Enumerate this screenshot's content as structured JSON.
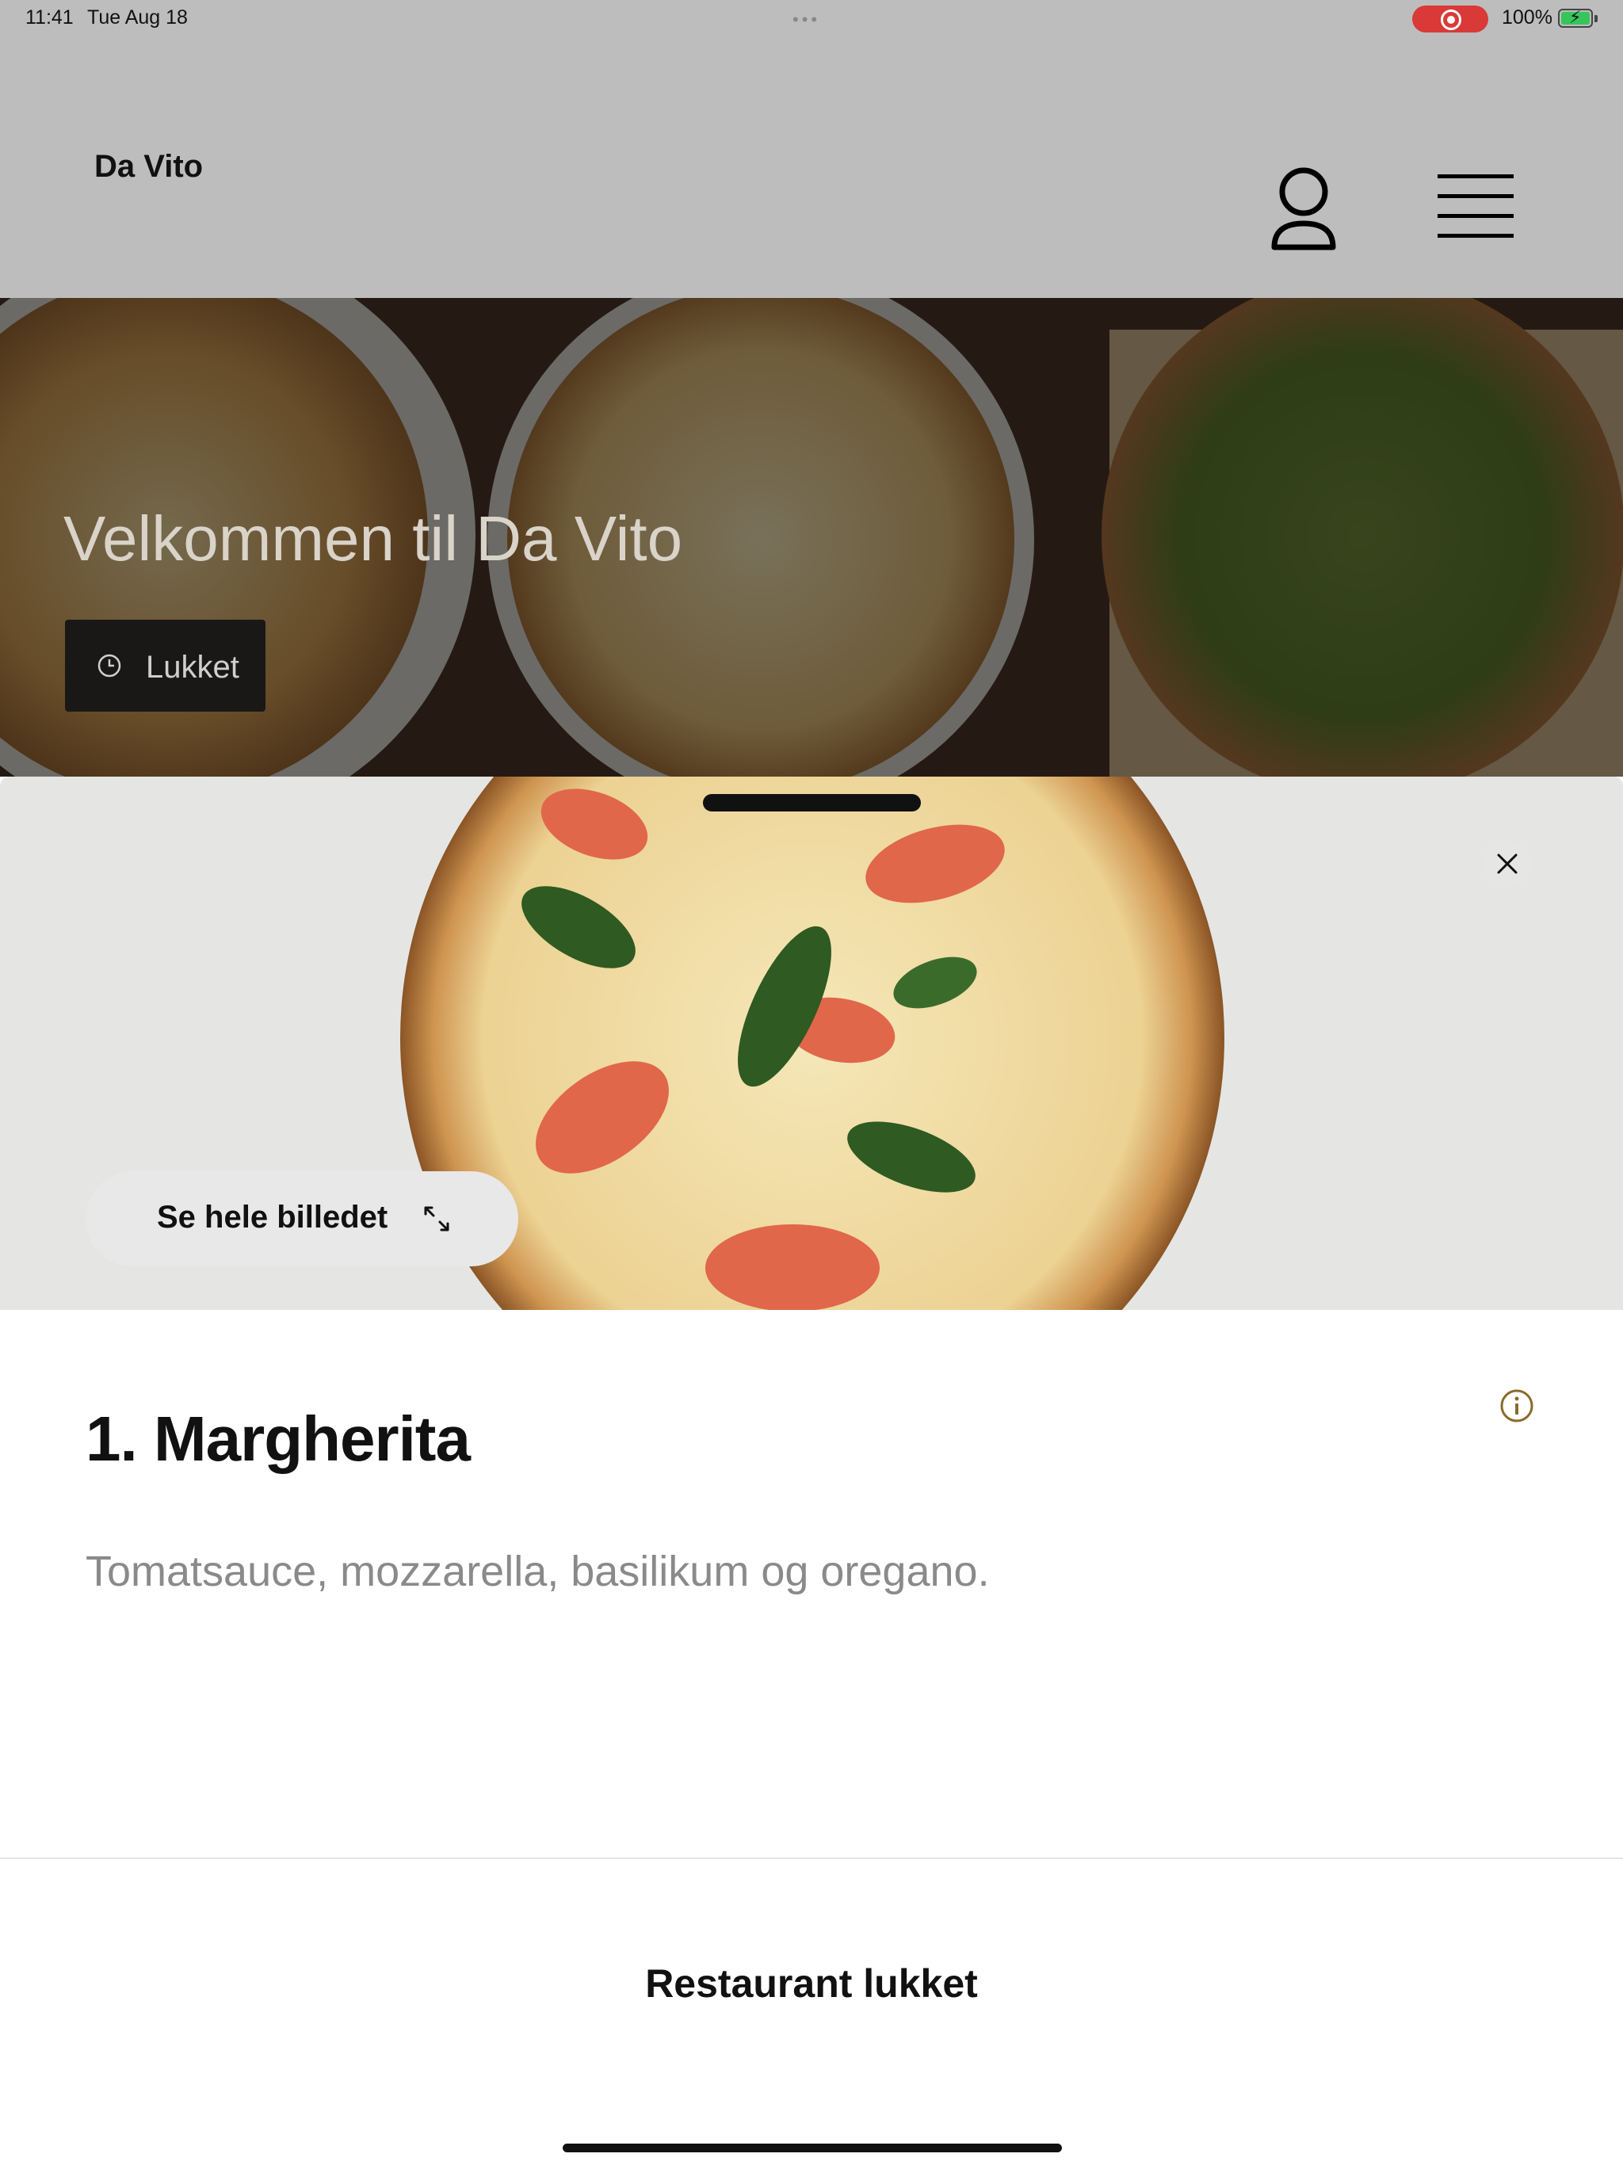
{
  "status_bar": {
    "time": "11:41",
    "date": "Tue Aug 18",
    "battery": "100%"
  },
  "header": {
    "brand": "Da Vito",
    "user_icon": "person-icon",
    "menu_icon": "hamburger-menu-icon"
  },
  "hero": {
    "title": "Velkommen til Da Vito",
    "status_label": "Lukket",
    "status_icon": "clock-icon"
  },
  "product": {
    "see_full_image_label": "Se hele billedet",
    "expand_icon": "expand-arrows-icon",
    "close_icon": "close-icon",
    "info_icon": "info-icon",
    "title": "1. Margherita",
    "description": "Tomatsauce, mozzarella, basilikum og oregano."
  },
  "footer": {
    "closed_label": "Restaurant lukket"
  },
  "colors": {
    "header_bg": "#bdbdbd",
    "record_red": "#d93a37",
    "battery_green": "#37c45a",
    "info_accent": "#8a6a2a"
  }
}
